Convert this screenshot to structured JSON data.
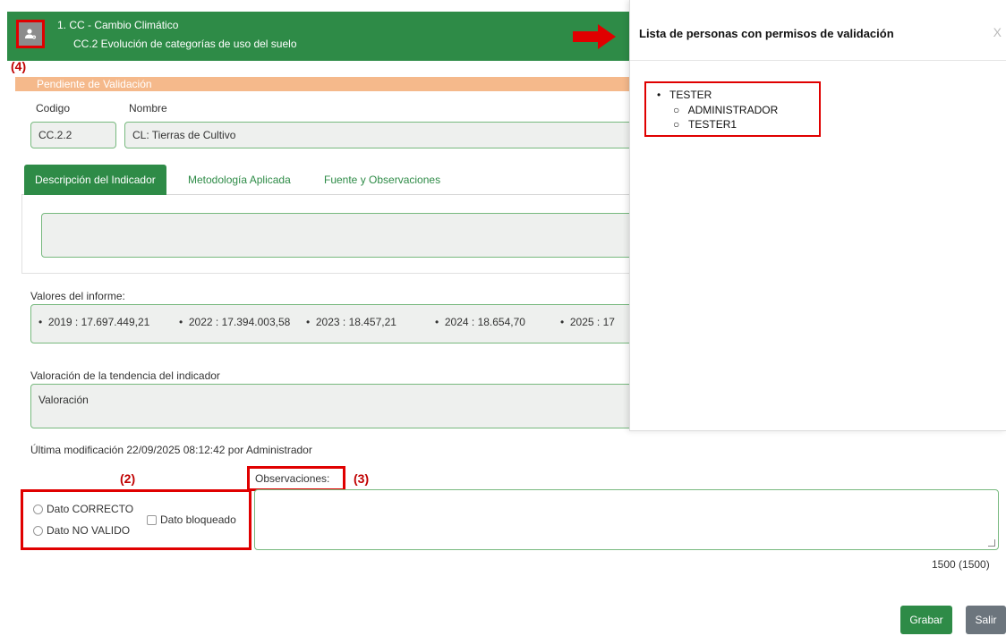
{
  "header": {
    "title": "1. CC - Cambio Climático",
    "subtitle": "CC.2 Evolución de categorías de uso del suelo"
  },
  "annotations": {
    "a4": "(4)",
    "a2": "(2)",
    "a3": "(3)"
  },
  "status": "Pendiente de Validación",
  "form": {
    "codigo_label": "Codigo",
    "nombre_label": "Nombre",
    "codigo_value": "CC.2.2",
    "nombre_value": "CL: Tierras de Cultivo"
  },
  "tabs": [
    {
      "label": "Descripción del Indicador",
      "active": true
    },
    {
      "label": "Metodología Aplicada",
      "active": false
    },
    {
      "label": "Fuente y Observaciones",
      "active": false
    }
  ],
  "valores": {
    "label": "Valores del informe:",
    "items": [
      "2019 : 17.697.449,21",
      "2022 : 17.394.003,58",
      "2023 : 18.457,21",
      "2024 : 18.654,70",
      "2025 : 17"
    ]
  },
  "valoracion": {
    "label": "Valoración de la tendencia del indicador",
    "value": "Valoración"
  },
  "last_modified": "Última modificación 22/09/2025 08:12:42 por Administrador",
  "validation": {
    "correcto": "Dato CORRECTO",
    "no_valido": "Dato NO VALIDO",
    "bloqueado": "Dato bloqueado"
  },
  "observaciones": {
    "label": "Observaciones:",
    "counter": "1500 (1500)"
  },
  "buttons": {
    "grabar": "Grabar",
    "salir": "Salir"
  },
  "side_panel": {
    "title": "Lista de personas con permisos de validación",
    "close": "X",
    "group": "TESTER",
    "members": [
      "ADMINISTRADOR",
      "TESTER1"
    ]
  },
  "colors": {
    "primary_green": "#2e8b47",
    "status_orange": "#f5b98b",
    "annotation_red": "#e00000",
    "secondary_gray": "#6c757d"
  }
}
